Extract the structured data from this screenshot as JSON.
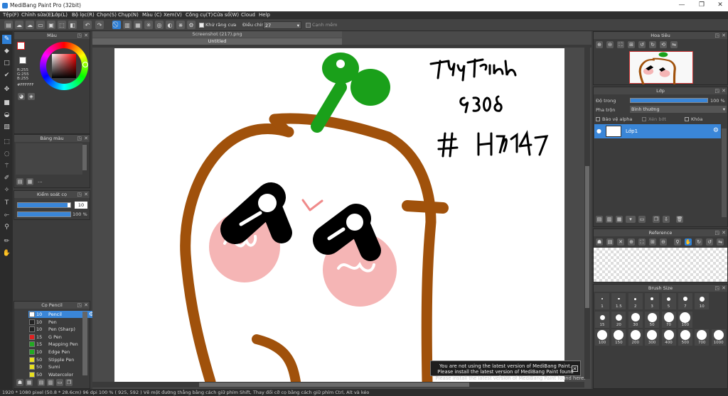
{
  "window": {
    "title": "MediBang Paint Pro (32bit)"
  },
  "menu": [
    "Tệp(F)",
    "Chỉnh sửa(E)",
    "Lớp(L)",
    "Bộ lọc(R)",
    "Chọn(S)",
    "Chụp(N)",
    "Màu (C)",
    "Xem(V)",
    "Công cụ(T)",
    "Cửa sổ(W)",
    "Cloud",
    "Help"
  ],
  "toolbar": {
    "antialias_label": "Khử răng cưa",
    "correction_label": "Điều chỉnh",
    "correction_value": "27",
    "edge_label": "Cạnh mềm"
  },
  "color_panel": {
    "title": "Màu",
    "r": "R:255",
    "g": "G:255",
    "b": "B:255",
    "hex": "#FFFFFF"
  },
  "palette_panel": {
    "title": "Bảng màu",
    "more": "..."
  },
  "brush_control": {
    "title": "Kiểm soát cọ",
    "size": "10",
    "opacity": "100 %",
    "size_fill": 0.95,
    "opacity_fill": 1.0
  },
  "brush_list": {
    "title": "Cọ Pencil",
    "items": [
      {
        "size": "10",
        "name": "Pencil",
        "color": "#ffffff",
        "selected": true
      },
      {
        "size": "10",
        "name": "Pen",
        "color": "#222222"
      },
      {
        "size": "10",
        "name": "Pen (Sharp)",
        "color": "#222222"
      },
      {
        "size": "15",
        "name": "G Pen",
        "color": "#e02020"
      },
      {
        "size": "15",
        "name": "Mapping Pen",
        "color": "#22aa22"
      },
      {
        "size": "10",
        "name": "Edge Pen",
        "color": "#22aa22"
      },
      {
        "size": "50",
        "name": "Stipple Pen",
        "color": "#e8e020"
      },
      {
        "size": "50",
        "name": "Sumi",
        "color": "#e8e020"
      },
      {
        "size": "50",
        "name": "Watercolor",
        "color": "#e8e020"
      }
    ]
  },
  "canvas": {
    "tab1": "Screenshot (217).png",
    "tab2": "Untitled"
  },
  "navigator": {
    "title": "Hoa tiêu"
  },
  "layers": {
    "title": "Lớp",
    "opacity_label": "Độ trong",
    "opacity_value": "100 %",
    "blend_label": "Pha trộn",
    "blend_value": "Bình thường",
    "protect_alpha": "Bảo vệ alpha",
    "clipping": "Xén bớt",
    "lock": "Khóa",
    "layer_name": "Lớp1"
  },
  "reference": {
    "title": "Reference"
  },
  "brush_size": {
    "title": "Brush Size",
    "row1": [
      "1",
      "1.5",
      "2",
      "3",
      "5",
      "7",
      "10"
    ],
    "row2": [
      "15",
      "20",
      "30",
      "50",
      "70",
      "100"
    ],
    "row3": [
      "100",
      "150",
      "200",
      "300",
      "400",
      "500",
      "700",
      "1000"
    ]
  },
  "status": {
    "text": "1920 * 1080 pixel   (50.8 * 28.6cm)   96 dpi   100 %   ( 925, 592 )   Vẽ một đường thẳng bằng cách giữ phím Shift, Thay đổi cỡ cọ bằng cách giữ phím Ctrl, Alt và kéo"
  },
  "notice": {
    "line1": "You are not using the latest version of MediBang Paint.",
    "line2": "Please install the latest version of MediBang Paint found here.",
    "line3": "Please install the latest version of MediBang Paint found here."
  },
  "colors": {
    "accent": "#2e7fd6",
    "stroke": "#a0510b",
    "sprout": "#1aa01a",
    "cheek": "#f5b5b5"
  }
}
